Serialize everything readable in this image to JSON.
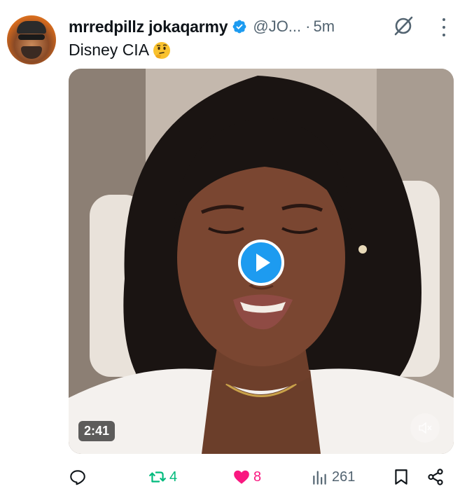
{
  "author": {
    "display_name": "mrredpillz jokaqarmy",
    "handle": "@JO...",
    "separator": "·",
    "time": "5m",
    "verified": true,
    "verified_color": "#1d9bf0"
  },
  "tweet": {
    "text": "Disney CIA",
    "emoji": "thinking-face-emoji"
  },
  "media": {
    "type": "video",
    "duration": "2:41",
    "play_icon": "play-icon",
    "mute_icon": "speaker-muted-icon"
  },
  "actions": {
    "reply": {
      "icon": "reply-icon",
      "count": ""
    },
    "retweet": {
      "icon": "retweet-icon",
      "count": "4",
      "color": "#00ba7c"
    },
    "like": {
      "icon": "heart-icon",
      "count": "8",
      "color": "#f91880"
    },
    "views": {
      "icon": "views-icon",
      "count": "261"
    },
    "bookmark": {
      "icon": "bookmark-icon"
    },
    "share": {
      "icon": "share-icon"
    }
  },
  "colors": {
    "text_primary": "#0f1419",
    "text_secondary": "#536471",
    "accent": "#1d9bf0"
  }
}
